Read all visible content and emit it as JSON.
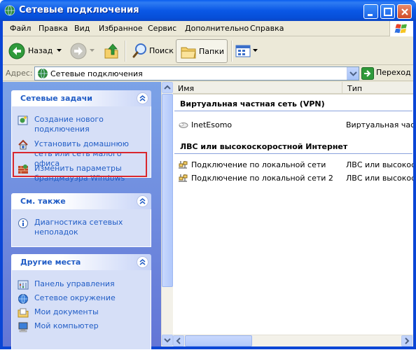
{
  "window": {
    "title": "Сетевые подключения"
  },
  "menubar": {
    "items": [
      "Файл",
      "Правка",
      "Вид",
      "Избранное",
      "Сервис",
      "Дополнительно",
      "Справка"
    ]
  },
  "toolbar": {
    "back_label": "Назад",
    "search_label": "Поиск",
    "folders_label": "Папки"
  },
  "addressbar": {
    "label": "Адрес:",
    "value": "Сетевые подключения",
    "go_label": "Переход"
  },
  "taskpane": {
    "network_tasks": {
      "title": "Сетевые задачи",
      "items": [
        {
          "label": "Создание нового подключения",
          "icon": "new-connection-icon"
        },
        {
          "label": "Установить домашнюю сеть или сеть малого офиса",
          "icon": "home-network-icon"
        },
        {
          "label": "Изменить параметры брандмауэра Windows",
          "icon": "firewall-icon"
        }
      ]
    },
    "see_also": {
      "title": "См. также",
      "items": [
        {
          "label": "Диагностика сетевых неполадок",
          "icon": "info-icon"
        }
      ]
    },
    "other_places": {
      "title": "Другие места",
      "items": [
        {
          "label": "Панель управления",
          "icon": "control-panel-icon"
        },
        {
          "label": "Сетевое окружение",
          "icon": "network-places-icon"
        },
        {
          "label": "Мои документы",
          "icon": "my-documents-icon"
        },
        {
          "label": "Мой компьютер",
          "icon": "my-computer-icon"
        }
      ]
    }
  },
  "list": {
    "columns": [
      "Имя",
      "Тип"
    ],
    "groups": [
      {
        "title": "Виртуальная частная сеть (VPN)",
        "rows": [
          {
            "name": "InetEsomo",
            "type": "Виртуальная частная сеть"
          }
        ]
      },
      {
        "title": "ЛВС или высокоскоростной Интернет",
        "rows": [
          {
            "name": "Подключение по локальной сети",
            "type": "ЛВС или высокоскоростной Интернет"
          },
          {
            "name": "Подключение по локальной сети 2",
            "type": "ЛВС или высокоскоростной Интернет"
          }
        ]
      }
    ]
  },
  "colors": {
    "title_blue": "#0a58e6",
    "task_link": "#215dc6",
    "highlight": "#d9272e",
    "pane_bg": "#6f8ee0"
  }
}
